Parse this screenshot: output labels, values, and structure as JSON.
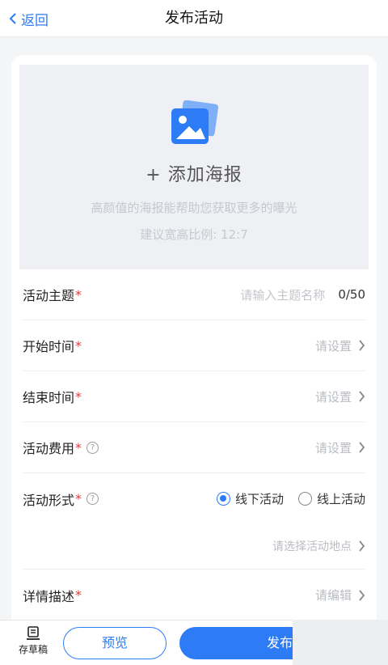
{
  "navbar": {
    "back_label": "返回",
    "title": "发布活动"
  },
  "poster": {
    "add_label": "+ 添加海报",
    "tip_line1": "高颜值的海报能帮助您获取更多的曝光",
    "tip_line2": "建议宽高比例: 12:7",
    "icon": "image-icon"
  },
  "form": {
    "theme": {
      "label": "活动主题",
      "required": "*",
      "placeholder": "请输入主题名称",
      "count": "0/50"
    },
    "start_time": {
      "label": "开始时间",
      "required": "*",
      "value": "请设置"
    },
    "end_time": {
      "label": "结束时间",
      "required": "*",
      "value": "请设置"
    },
    "fee": {
      "label": "活动费用",
      "required": "*",
      "help": "?",
      "value": "请设置"
    },
    "format": {
      "label": "活动形式",
      "required": "*",
      "help": "?",
      "options": [
        {
          "label": "线下活动",
          "selected": true
        },
        {
          "label": "线上活动",
          "selected": false
        }
      ],
      "location_placeholder": "请选择活动地点"
    },
    "detail": {
      "label": "详情描述",
      "required": "*",
      "value": "请编辑"
    }
  },
  "bottom": {
    "draft_label": "存草稿",
    "preview_label": "预览",
    "publish_label": "发布"
  },
  "colors": {
    "accent": "#2d7cf6",
    "required": "#e33b3b",
    "background": "#f4f5f7"
  }
}
